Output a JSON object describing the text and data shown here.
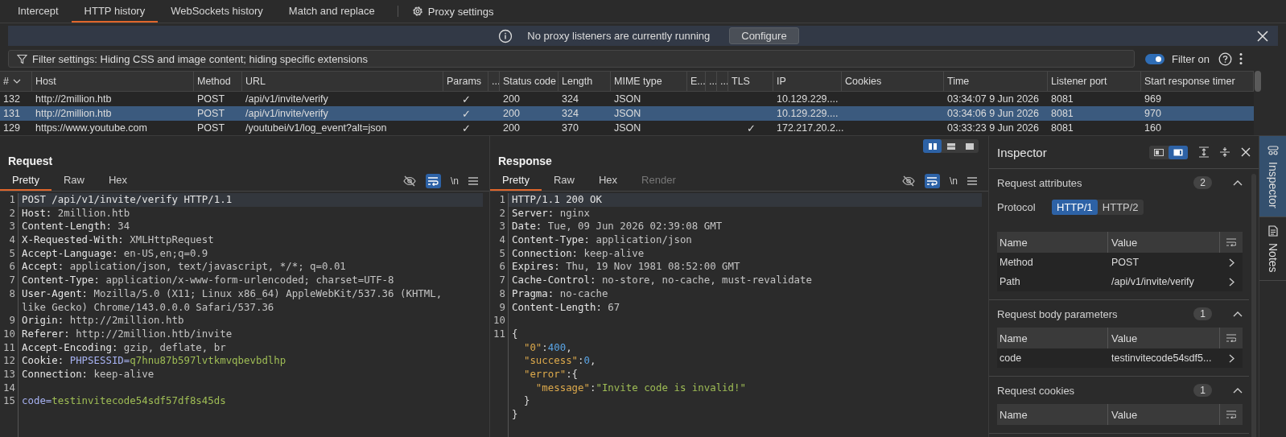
{
  "proxy_tabs": [
    {
      "label": "Intercept",
      "selected": false
    },
    {
      "label": "HTTP history",
      "selected": true
    },
    {
      "label": "WebSockets history",
      "selected": false
    },
    {
      "label": "Match and replace",
      "selected": false
    }
  ],
  "proxy_settings": {
    "label": "Proxy settings"
  },
  "notification": {
    "message": "No proxy listeners are currently running",
    "button": "Configure"
  },
  "filter": {
    "text": "Filter settings: Hiding CSS and image content; hiding specific extensions",
    "toggle_label": "Filter on",
    "on": true
  },
  "history": {
    "columns": [
      "#",
      "Host",
      "Method",
      "URL",
      "Params",
      "...",
      "Status code",
      "Length",
      "MIME type",
      "E...",
      "...",
      "...",
      "TLS",
      "IP",
      "Cookies",
      "Time",
      "Listener port",
      "Start response timer"
    ],
    "rows": [
      {
        "selected": false,
        "number": "132",
        "host": "http://2million.htb",
        "method": "POST",
        "url": "/api/v1/invite/verify",
        "params": "✓",
        "status_code": "200",
        "length": "324",
        "mime_type": "JSON",
        "ip": "10.129.229....",
        "time": "03:34:07 9 Jun 2026",
        "listener_port": "8081",
        "start_response_timer": "969"
      },
      {
        "selected": true,
        "number": "131",
        "host": "http://2million.htb",
        "method": "POST",
        "url": "/api/v1/invite/verify",
        "params": "✓",
        "status_code": "200",
        "length": "324",
        "mime_type": "JSON",
        "ip": "10.129.229....",
        "time": "03:34:06 9 Jun 2026",
        "listener_port": "8081",
        "start_response_timer": "970"
      },
      {
        "selected": false,
        "number": "129",
        "host": "https://www.youtube.com",
        "method": "POST",
        "url": "/youtubei/v1/log_event?alt=json",
        "params": "✓",
        "status_code": "200",
        "length": "370",
        "mime_type": "JSON",
        "tls": "✓",
        "ip": "172.217.20.2...",
        "time": "03:33:23 9 Jun 2026",
        "listener_port": "8081",
        "start_response_timer": "160"
      }
    ]
  },
  "request": {
    "title": "Request",
    "tabs": [
      {
        "label": "Pretty",
        "selected": true,
        "disabled": false
      },
      {
        "label": "Raw",
        "selected": false,
        "disabled": false
      },
      {
        "label": "Hex",
        "selected": false,
        "disabled": false
      }
    ],
    "wrap_lines": true,
    "newline_label": "\\n",
    "lines": [
      {
        "number": "1",
        "highlighted": true,
        "rows": [
          {
            "segments": [
              {
                "text": "POST /api/v1/invite/verify HTTP/1.1",
                "kind": "name"
              }
            ]
          }
        ]
      },
      {
        "number": "2",
        "highlighted": false,
        "rows": [
          {
            "segments": [
              {
                "text": "Host:",
                "kind": "name"
              },
              {
                "text": " 2million.htb",
                "kind": "value"
              }
            ]
          }
        ]
      },
      {
        "number": "3",
        "highlighted": false,
        "rows": [
          {
            "segments": [
              {
                "text": "Content-Length:",
                "kind": "name"
              },
              {
                "text": " 34",
                "kind": "value"
              }
            ]
          }
        ]
      },
      {
        "number": "4",
        "highlighted": false,
        "rows": [
          {
            "segments": [
              {
                "text": "X-Requested-With:",
                "kind": "name"
              },
              {
                "text": " XMLHttpRequest",
                "kind": "value"
              }
            ]
          }
        ]
      },
      {
        "number": "5",
        "highlighted": false,
        "rows": [
          {
            "segments": [
              {
                "text": "Accept-Language:",
                "kind": "name"
              },
              {
                "text": " en-US,en;q=0.9",
                "kind": "value"
              }
            ]
          }
        ]
      },
      {
        "number": "6",
        "highlighted": false,
        "rows": [
          {
            "segments": [
              {
                "text": "Accept:",
                "kind": "name"
              },
              {
                "text": " application/json, text/javascript, */*; q=0.01",
                "kind": "value"
              }
            ]
          }
        ]
      },
      {
        "number": "7",
        "highlighted": false,
        "rows": [
          {
            "segments": [
              {
                "text": "Content-Type:",
                "kind": "name"
              },
              {
                "text": " application/x-www-form-urlencoded; charset=UTF-8",
                "kind": "value"
              }
            ]
          }
        ]
      },
      {
        "number": "8",
        "highlighted": false,
        "rows": [
          {
            "segments": [
              {
                "text": "User-Agent:",
                "kind": "name"
              },
              {
                "text": " Mozilla/5.0 (X11; Linux x86_64) AppleWebKit/537.36 (KHTML,",
                "kind": "value"
              }
            ]
          },
          {
            "segments": [
              {
                "text": "like Gecko) Chrome/143.0.0.0 Safari/537.36",
                "kind": "value"
              }
            ]
          }
        ]
      },
      {
        "number": "9",
        "highlighted": false,
        "rows": [
          {
            "segments": [
              {
                "text": "Origin:",
                "kind": "name"
              },
              {
                "text": " http://2million.htb",
                "kind": "value"
              }
            ]
          }
        ]
      },
      {
        "number": "10",
        "highlighted": false,
        "rows": [
          {
            "segments": [
              {
                "text": "Referer:",
                "kind": "name"
              },
              {
                "text": " http://2million.htb/invite",
                "kind": "value"
              }
            ]
          }
        ]
      },
      {
        "number": "11",
        "highlighted": false,
        "rows": [
          {
            "segments": [
              {
                "text": "Accept-Encoding:",
                "kind": "name"
              },
              {
                "text": " gzip, deflate, br",
                "kind": "value"
              }
            ]
          }
        ]
      },
      {
        "number": "12",
        "highlighted": false,
        "rows": [
          {
            "segments": [
              {
                "text": "Cookie:",
                "kind": "name"
              },
              {
                "text": " PHPSESSID=",
                "kind": "param-name"
              },
              {
                "text": "q7hnu87b597lvtkmvqbevbdlhp",
                "kind": "param-value"
              }
            ]
          }
        ]
      },
      {
        "number": "13",
        "highlighted": false,
        "rows": [
          {
            "segments": [
              {
                "text": "Connection:",
                "kind": "name"
              },
              {
                "text": " keep-alive",
                "kind": "value"
              }
            ]
          }
        ]
      },
      {
        "number": "14",
        "highlighted": false
      },
      {
        "number": "15",
        "highlighted": false,
        "rows": [
          {
            "segments": [
              {
                "text": "code=",
                "kind": "param-name"
              },
              {
                "text": "testinvitecode54sdf57df8s45ds",
                "kind": "param-value"
              }
            ]
          }
        ]
      }
    ]
  },
  "response": {
    "title": "Response",
    "tabs": [
      {
        "label": "Pretty",
        "selected": true,
        "disabled": false
      },
      {
        "label": "Raw",
        "selected": false,
        "disabled": false
      },
      {
        "label": "Hex",
        "selected": false,
        "disabled": false
      },
      {
        "label": "Render",
        "selected": false,
        "disabled": true
      }
    ],
    "layout_buttons": [
      {
        "kind": "columns",
        "selected": true
      },
      {
        "kind": "rows",
        "selected": false
      },
      {
        "kind": "single",
        "selected": false
      }
    ],
    "wrap_lines": true,
    "newline_label": "\\n",
    "lines": [
      {
        "number": "1",
        "highlighted": true,
        "rows": [
          {
            "segments": [
              {
                "text": "HTTP/1.1 200 OK",
                "kind": "name"
              }
            ]
          }
        ]
      },
      {
        "number": "2",
        "highlighted": false,
        "rows": [
          {
            "segments": [
              {
                "text": "Server:",
                "kind": "name"
              },
              {
                "text": " nginx",
                "kind": "value"
              }
            ]
          }
        ]
      },
      {
        "number": "3",
        "highlighted": false,
        "rows": [
          {
            "segments": [
              {
                "text": "Date:",
                "kind": "name"
              },
              {
                "text": " Tue, 09 Jun 2026 02:39:08 GMT",
                "kind": "value"
              }
            ]
          }
        ]
      },
      {
        "number": "4",
        "highlighted": false,
        "rows": [
          {
            "segments": [
              {
                "text": "Content-Type:",
                "kind": "name"
              },
              {
                "text": " application/json",
                "kind": "value"
              }
            ]
          }
        ]
      },
      {
        "number": "5",
        "highlighted": false,
        "rows": [
          {
            "segments": [
              {
                "text": "Connection:",
                "kind": "name"
              },
              {
                "text": " keep-alive",
                "kind": "value"
              }
            ]
          }
        ]
      },
      {
        "number": "6",
        "highlighted": false,
        "rows": [
          {
            "segments": [
              {
                "text": "Expires:",
                "kind": "name"
              },
              {
                "text": " Thu, 19 Nov 1981 08:52:00 GMT",
                "kind": "value"
              }
            ]
          }
        ]
      },
      {
        "number": "7",
        "highlighted": false,
        "rows": [
          {
            "segments": [
              {
                "text": "Cache-Control:",
                "kind": "name"
              },
              {
                "text": " no-store, no-cache, must-revalidate",
                "kind": "value"
              }
            ]
          }
        ]
      },
      {
        "number": "8",
        "highlighted": false,
        "rows": [
          {
            "segments": [
              {
                "text": "Pragma:",
                "kind": "name"
              },
              {
                "text": " no-cache",
                "kind": "value"
              }
            ]
          }
        ]
      },
      {
        "number": "9",
        "highlighted": false,
        "rows": [
          {
            "segments": [
              {
                "text": "Content-Length:",
                "kind": "name"
              },
              {
                "text": " 67",
                "kind": "value"
              }
            ]
          }
        ]
      },
      {
        "number": "10",
        "highlighted": false
      },
      {
        "number": "11",
        "highlighted": false,
        "rows": [
          {
            "segments": [
              {
                "text": "{",
                "kind": "punct"
              }
            ]
          },
          {
            "segments": [
              {
                "text": "  \"0\"",
                "kind": "key"
              },
              {
                "text": ":",
                "kind": "punct"
              },
              {
                "text": "400",
                "kind": "number"
              },
              {
                "text": ",",
                "kind": "punct"
              }
            ]
          },
          {
            "segments": [
              {
                "text": "  \"success\"",
                "kind": "key"
              },
              {
                "text": ":",
                "kind": "punct"
              },
              {
                "text": "0",
                "kind": "number"
              },
              {
                "text": ",",
                "kind": "punct"
              }
            ]
          },
          {
            "segments": [
              {
                "text": "  \"error\"",
                "kind": "key"
              },
              {
                "text": ":{",
                "kind": "punct"
              }
            ]
          },
          {
            "segments": [
              {
                "text": "    \"message\"",
                "kind": "key"
              },
              {
                "text": ":",
                "kind": "punct"
              },
              {
                "text": "\"Invite code is invalid!\"",
                "kind": "string"
              }
            ]
          },
          {
            "segments": [
              {
                "text": "  }",
                "kind": "punct"
              }
            ]
          },
          {
            "segments": [
              {
                "text": "}",
                "kind": "punct"
              }
            ]
          }
        ]
      }
    ]
  },
  "inspector": {
    "title": "Inspector",
    "layout_buttons": [
      {
        "kind": "panel-left",
        "selected": false
      },
      {
        "kind": "panel-right",
        "selected": true
      }
    ],
    "sections": [
      {
        "title": "Request attributes",
        "count": "2",
        "expanded": true,
        "protocol": {
          "label": "Protocol",
          "options": [
            {
              "label": "HTTP/1",
              "selected": true
            },
            {
              "label": "HTTP/2",
              "selected": false
            }
          ]
        },
        "table": {
          "columns": [
            "Name",
            "Value"
          ],
          "rows": [
            {
              "name": "Method",
              "value": "POST"
            },
            {
              "name": "Path",
              "value": "/api/v1/invite/verify"
            }
          ]
        }
      },
      {
        "title": "Request body parameters",
        "count": "1",
        "expanded": true,
        "table": {
          "columns": [
            "Name",
            "Value"
          ],
          "rows": [
            {
              "name": "code",
              "value": "testinvitecode54sdf5..."
            }
          ]
        }
      },
      {
        "title": "Request cookies",
        "count": "1",
        "expanded": true,
        "table": {
          "columns": [
            "Name",
            "Value"
          ]
        }
      }
    ]
  },
  "side_tabs": [
    {
      "label": "Inspector",
      "kind": "inspector",
      "selected": true
    },
    {
      "label": "Notes",
      "kind": "notes",
      "selected": false
    }
  ]
}
